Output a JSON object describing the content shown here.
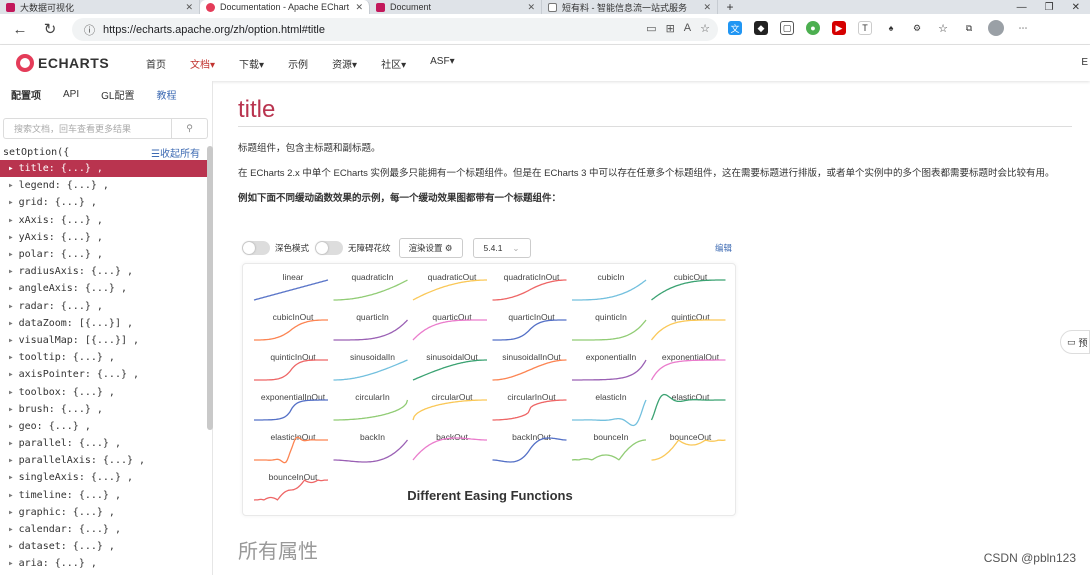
{
  "browser": {
    "tabs": [
      {
        "label": "大数据可视化",
        "color": "#c2185b",
        "active": false
      },
      {
        "label": "Documentation - Apache EChart",
        "color": "#e43c59",
        "active": true
      },
      {
        "label": "Document",
        "color": "#c2185b",
        "active": false
      },
      {
        "label": "短有料 - 智能信息流一站式服务",
        "color": "#777777",
        "active": false
      }
    ],
    "url": "https://echarts.apache.org/zh/option.html#title"
  },
  "header": {
    "logo": "ECHARTS",
    "menu": [
      {
        "label": "首页"
      },
      {
        "label": "文档▾"
      },
      {
        "label": "下载▾"
      },
      {
        "label": "示例"
      },
      {
        "label": "资源▾"
      },
      {
        "label": "社区▾"
      },
      {
        "label": "ASF▾"
      }
    ],
    "right_text": "E"
  },
  "sidebar": {
    "tabs": [
      "配置项",
      "API",
      "GL配置",
      "教程"
    ],
    "search_placeholder": "搜索文档，回车查看更多结果",
    "root": "setOption({",
    "collapse_label": "☰收起所有",
    "items": [
      "title: {...} ,",
      "legend: {...} ,",
      "grid: {...} ,",
      "xAxis: {...} ,",
      "yAxis: {...} ,",
      "polar: {...} ,",
      "radiusAxis: {...} ,",
      "angleAxis: {...} ,",
      "radar: {...} ,",
      "dataZoom: [{...}] ,",
      "visualMap: [{...}] ,",
      "tooltip: {...} ,",
      "axisPointer: {...} ,",
      "toolbox: {...} ,",
      "brush: {...} ,",
      "geo: {...} ,",
      "parallel: {...} ,",
      "parallelAxis: {...} ,",
      "singleAxis: {...} ,",
      "timeline: {...} ,",
      "graphic: {...} ,",
      "calendar: {...} ,",
      "dataset: {...} ,",
      "aria: {...} ,"
    ]
  },
  "content": {
    "title": "title",
    "p1": "标题组件，包含主标题和副标题。",
    "p2": "在 ECharts 2.x 中单个 ECharts 实例最多只能拥有一个标题组件。但是在 ECharts 3 中可以存在任意多个标题组件，这在需要标题进行排版，或者单个实例中的多个图表都需要标题时会比较有用。",
    "p3": "例如下面不同缓动函数效果的示例，每一个缓动效果图都带有一个标题组件：",
    "controls": {
      "dark_mode": "深色模式",
      "no_anim": "无障碍花纹",
      "render_settings": "渲染设置 ⚙",
      "version": "5.4.1",
      "edit": "编辑"
    },
    "all_props": "所有属性"
  },
  "chart_data": {
    "type": "line",
    "title": "Different Easing Functions",
    "panels": [
      {
        "name": "linear",
        "color": "#5470c6"
      },
      {
        "name": "quadraticIn",
        "color": "#91cc75"
      },
      {
        "name": "quadraticOut",
        "color": "#fac858"
      },
      {
        "name": "quadraticInOut",
        "color": "#ee6666"
      },
      {
        "name": "cubicIn",
        "color": "#73c0de"
      },
      {
        "name": "cubicOut",
        "color": "#3ba272"
      },
      {
        "name": "cubicInOut",
        "color": "#fc8452"
      },
      {
        "name": "quarticIn",
        "color": "#9a60b4"
      },
      {
        "name": "quarticOut",
        "color": "#ea7ccc"
      },
      {
        "name": "quarticInOut",
        "color": "#5470c6"
      },
      {
        "name": "quinticIn",
        "color": "#91cc75"
      },
      {
        "name": "quinticOut",
        "color": "#fac858"
      },
      {
        "name": "quinticInOut",
        "color": "#ee6666"
      },
      {
        "name": "sinusoidalIn",
        "color": "#73c0de"
      },
      {
        "name": "sinusoidalOut",
        "color": "#3ba272"
      },
      {
        "name": "sinusoidalInOut",
        "color": "#fc8452"
      },
      {
        "name": "exponentialIn",
        "color": "#9a60b4"
      },
      {
        "name": "exponentialOut",
        "color": "#ea7ccc"
      },
      {
        "name": "exponentialInOut",
        "color": "#5470c6"
      },
      {
        "name": "circularIn",
        "color": "#91cc75"
      },
      {
        "name": "circularOut",
        "color": "#fac858"
      },
      {
        "name": "circularInOut",
        "color": "#ee6666"
      },
      {
        "name": "elasticIn",
        "color": "#73c0de"
      },
      {
        "name": "elasticOut",
        "color": "#3ba272"
      },
      {
        "name": "elasticInOut",
        "color": "#fc8452"
      },
      {
        "name": "backIn",
        "color": "#9a60b4"
      },
      {
        "name": "backOut",
        "color": "#ea7ccc"
      },
      {
        "name": "backInOut",
        "color": "#5470c6"
      },
      {
        "name": "bounceIn",
        "color": "#91cc75"
      },
      {
        "name": "bounceOut",
        "color": "#fac858"
      },
      {
        "name": "bounceInOut",
        "color": "#ee6666"
      }
    ]
  },
  "misc": {
    "float_label": "预",
    "watermark": "CSDN @pbln123"
  }
}
